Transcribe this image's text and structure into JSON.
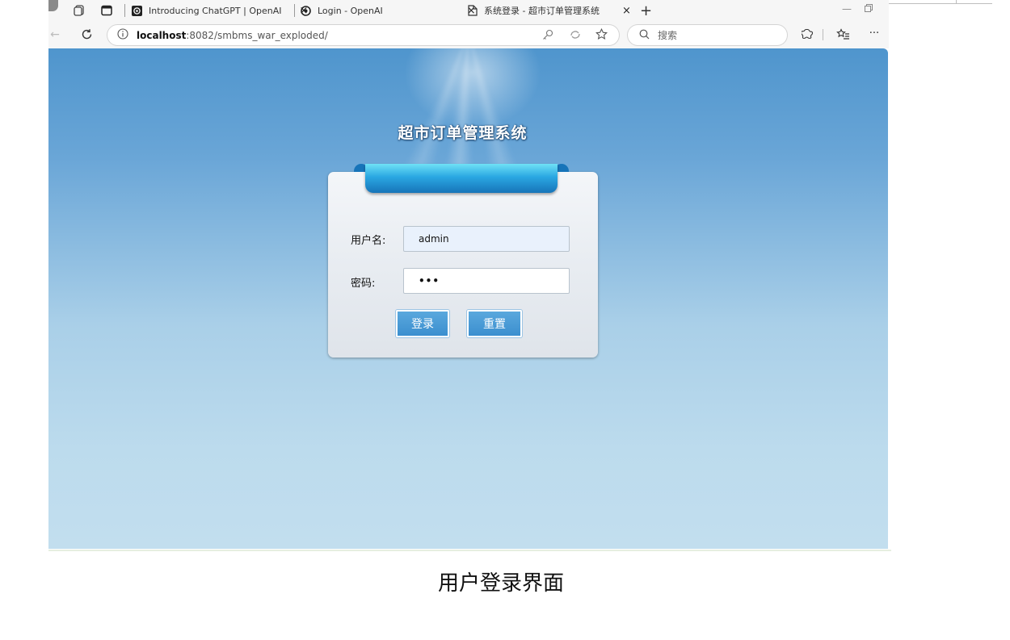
{
  "browser": {
    "tabs": [
      {
        "title": "Introducing ChatGPT | OpenAI",
        "favicon": "openai-icon"
      },
      {
        "title": "Login - OpenAI",
        "favicon": "openai-icon"
      },
      {
        "title": "系统登录 - 超市订单管理系统",
        "favicon": "page-icon",
        "active": true
      }
    ],
    "new_tab_label": "+",
    "close_label": "×",
    "url_host": "localhost",
    "url_rest": ":8082/smbms_war_exploded/",
    "search_placeholder": "搜索",
    "more_label": "···"
  },
  "page": {
    "title": "超市订单管理系统",
    "username_label": "用户名:",
    "username_value": "admin",
    "password_label": "密码:",
    "password_value": "•••",
    "login_button": "登录",
    "reset_button": "重置"
  },
  "caption": "用户登录界面",
  "colors": {
    "accent": "#3b8fcf",
    "background_top": "#4f95cd",
    "background_bottom": "#c2deee"
  }
}
